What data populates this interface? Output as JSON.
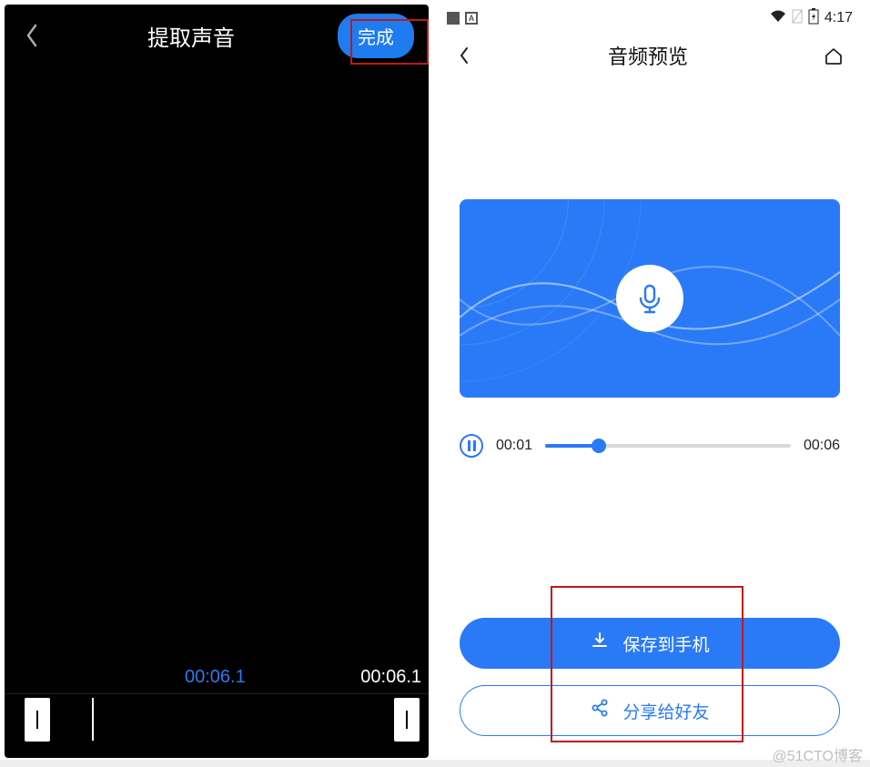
{
  "left": {
    "title": "提取声音",
    "done_label": "完成",
    "time_current": "00:06.1",
    "time_total": "00:06.1"
  },
  "right": {
    "status": {
      "time": "4:17"
    },
    "title": "音频预览",
    "player": {
      "current": "00:01",
      "total": "00:06"
    },
    "buttons": {
      "save": "保存到手机",
      "share": "分享给好友"
    }
  },
  "watermark": "@51CTO博客"
}
